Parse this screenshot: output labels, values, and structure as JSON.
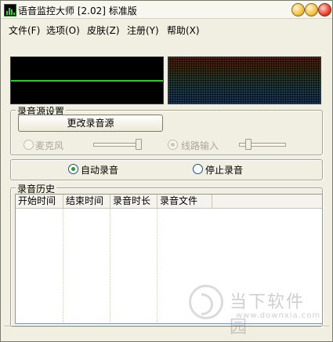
{
  "window": {
    "title": "语音监控大师 [2.02] 标准版",
    "icon": "app-bars-icon"
  },
  "menu": {
    "items": [
      "文件(F)",
      "选项(O)",
      "皮肤(Z)",
      "注册(Y)",
      "帮助(X)"
    ]
  },
  "source_group": {
    "label": "录音源设置",
    "change_button": "更改录音源",
    "mic_label": "麦克风",
    "line_label": "线路输入",
    "mic_slider_level": 0.9,
    "line_slider_level": 0.15
  },
  "mode": {
    "auto_label": "自动录音",
    "stop_label": "停止录音",
    "selected": "auto"
  },
  "history": {
    "label": "录音历史",
    "columns": [
      "开始时间",
      "结束时间",
      "录音时长",
      "录音文件"
    ],
    "rows": []
  },
  "watermark": {
    "text": "当下软件园",
    "url": "www.downxia.com"
  },
  "colors": {
    "scope_line": "#22d12a",
    "radio_dot": "#21a121"
  }
}
